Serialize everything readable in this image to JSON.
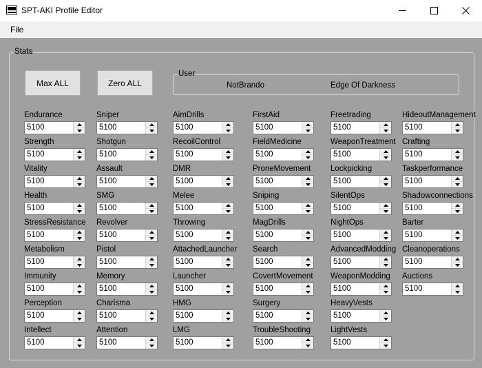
{
  "window": {
    "title": "SPT-AKI Profile Editor"
  },
  "menu": {
    "file": "File"
  },
  "stats_group": {
    "label": "Stats"
  },
  "buttons": {
    "max_all": "Max ALL",
    "zero_all": "Zero ALL"
  },
  "user": {
    "label": "User",
    "name": "NotBrando",
    "edition": "Edge Of Darkness"
  },
  "skills": [
    [
      {
        "label": "Endurance",
        "value": "5100"
      },
      {
        "label": "Strength",
        "value": "5100"
      },
      {
        "label": "Vitality",
        "value": "5100"
      },
      {
        "label": "Health",
        "value": "5100"
      },
      {
        "label": "StressResistance",
        "value": "5100"
      },
      {
        "label": "Metabolism",
        "value": "5100"
      },
      {
        "label": "Immunity",
        "value": "5100"
      },
      {
        "label": "Perception",
        "value": "5100"
      },
      {
        "label": "Intellect",
        "value": "5100"
      }
    ],
    [
      {
        "label": "Sniper",
        "value": "5100"
      },
      {
        "label": "Shotgun",
        "value": "5100"
      },
      {
        "label": "Assault",
        "value": "5100"
      },
      {
        "label": "SMG",
        "value": "5100"
      },
      {
        "label": "Revolver",
        "value": "5100"
      },
      {
        "label": "Pistol",
        "value": "5100"
      },
      {
        "label": "Memory",
        "value": "5100"
      },
      {
        "label": "Charisma",
        "value": "5100"
      },
      {
        "label": "Attention",
        "value": "5100"
      }
    ],
    [
      {
        "label": "AimDrills",
        "value": "5100"
      },
      {
        "label": "RecoilControl",
        "value": "5100"
      },
      {
        "label": "DMR",
        "value": "5100"
      },
      {
        "label": "Melee",
        "value": "5100"
      },
      {
        "label": "Throwing",
        "value": "5100"
      },
      {
        "label": "AttachedLauncher",
        "value": "5100"
      },
      {
        "label": "Launcher",
        "value": "5100"
      },
      {
        "label": "HMG",
        "value": "5100"
      },
      {
        "label": "LMG",
        "value": "5100"
      }
    ],
    [
      {
        "label": "FirstAid",
        "value": "5100"
      },
      {
        "label": "FieldMedicine",
        "value": "5100"
      },
      {
        "label": "ProneMovement",
        "value": "5100"
      },
      {
        "label": "Sniping",
        "value": "5100"
      },
      {
        "label": "MagDrills",
        "value": "5100"
      },
      {
        "label": "Search",
        "value": "5100"
      },
      {
        "label": "CovertMovement",
        "value": "5100"
      },
      {
        "label": "Surgery",
        "value": "5100"
      },
      {
        "label": "TroubleShooting",
        "value": "5100"
      }
    ],
    [
      {
        "label": "Freetrading",
        "value": "5100"
      },
      {
        "label": "WeaponTreatment",
        "value": "5100"
      },
      {
        "label": "Lockpicking",
        "value": "5100"
      },
      {
        "label": "SilentOps",
        "value": "5100"
      },
      {
        "label": "NightOps",
        "value": "5100"
      },
      {
        "label": "AdvancedModding",
        "value": "5100"
      },
      {
        "label": "WeaponModding",
        "value": "5100"
      },
      {
        "label": "HeavyVests",
        "value": "5100"
      },
      {
        "label": "LightVests",
        "value": "5100"
      }
    ],
    [
      {
        "label": "HideoutManagement",
        "value": "5100"
      },
      {
        "label": "Crafting",
        "value": "5100"
      },
      {
        "label": "Taskperformance",
        "value": "5100"
      },
      {
        "label": "Shadowconnections",
        "value": "5100"
      },
      {
        "label": "Barter",
        "value": "5100"
      },
      {
        "label": "Cleanoperations",
        "value": "5100"
      },
      {
        "label": "Auctions",
        "value": "5100"
      }
    ]
  ]
}
